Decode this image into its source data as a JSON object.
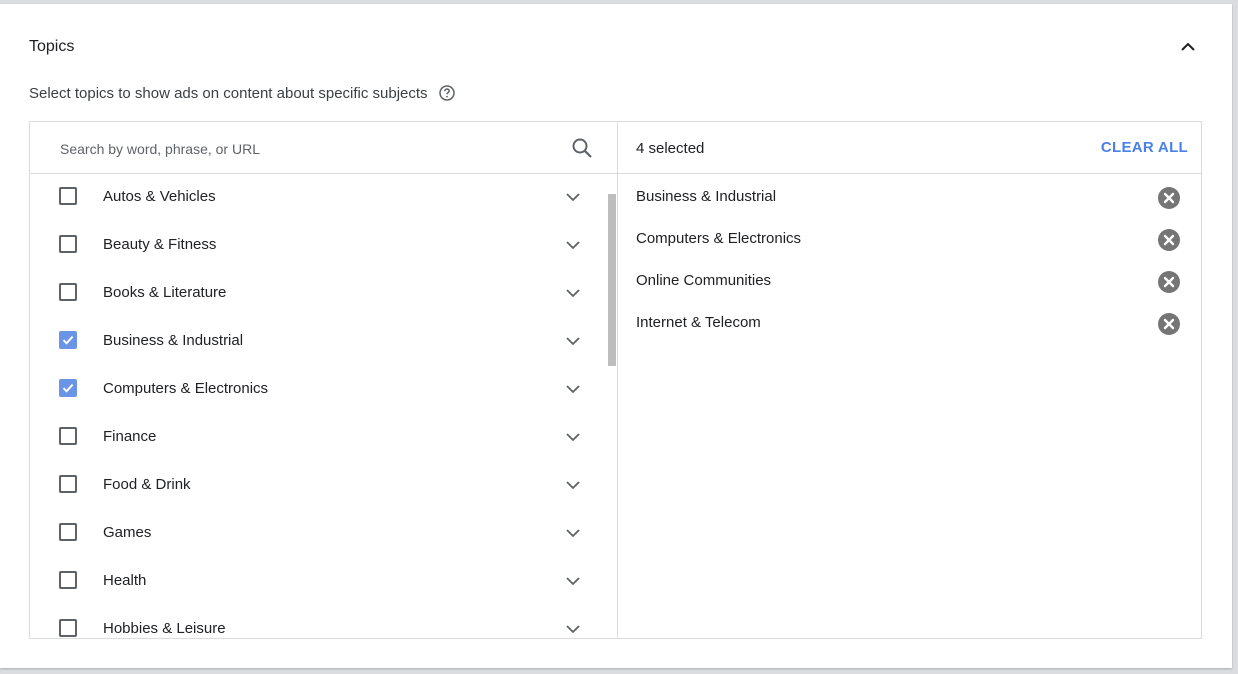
{
  "section": {
    "title": "Topics",
    "subtitle": "Select topics to show ads on content about specific subjects"
  },
  "search": {
    "placeholder": "Search by word, phrase, or URL",
    "value": ""
  },
  "topics": [
    {
      "label": "Autos & Vehicles",
      "checked": false
    },
    {
      "label": "Beauty & Fitness",
      "checked": false
    },
    {
      "label": "Books & Literature",
      "checked": false
    },
    {
      "label": "Business & Industrial",
      "checked": true
    },
    {
      "label": "Computers & Electronics",
      "checked": true
    },
    {
      "label": "Finance",
      "checked": false
    },
    {
      "label": "Food & Drink",
      "checked": false
    },
    {
      "label": "Games",
      "checked": false
    },
    {
      "label": "Health",
      "checked": false
    },
    {
      "label": "Hobbies & Leisure",
      "checked": false
    }
  ],
  "selected": {
    "count_label": "4 selected",
    "clear_all_label": "CLEAR ALL",
    "items": [
      {
        "label": "Business & Industrial"
      },
      {
        "label": "Computers & Electronics"
      },
      {
        "label": "Online Communities"
      },
      {
        "label": "Internet & Telecom"
      }
    ]
  },
  "colors": {
    "accent": "#4a81e8",
    "checkbox_checked": "#6a94e6",
    "icon_gray": "#5f6368",
    "remove_icon": "#757575"
  },
  "icons": {
    "collapse": "chevron-up-icon",
    "help": "help-circle-icon",
    "search": "search-icon",
    "expand": "chevron-down-icon",
    "remove": "close-circle-icon",
    "check": "check-icon"
  }
}
